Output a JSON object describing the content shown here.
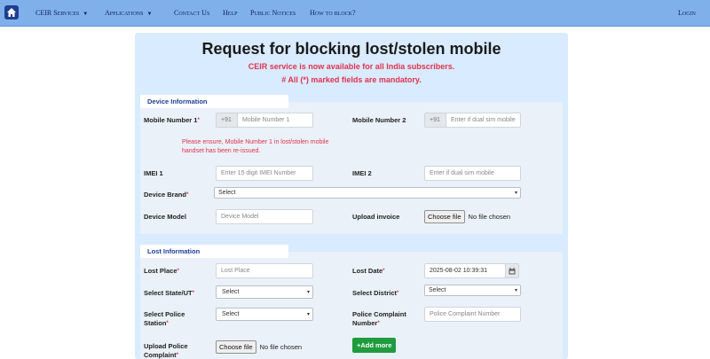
{
  "nav": {
    "items": [
      {
        "label": "CEIR Services",
        "caret": "▼"
      },
      {
        "label": "Applications",
        "caret": "▼"
      },
      {
        "label": "Contact Us"
      },
      {
        "label": "Help"
      },
      {
        "label": "Public Notices"
      },
      {
        "label": "How to block?"
      }
    ],
    "login": "Login"
  },
  "header": {
    "title": "Request for blocking lost/stolen mobile",
    "notice1": "CEIR service is now available for all India subscribers.",
    "notice2": "# All (*) marked fields are mandatory."
  },
  "device": {
    "section_title": "Device Information",
    "mobile1_label": "Mobile Number 1",
    "mobile1_prefix": "+91",
    "mobile1_placeholder": "Mobile Number 1",
    "mobile2_label": "Mobile Number 2",
    "mobile2_prefix": "+91",
    "mobile2_placeholder": "Enter if dual sim mobile",
    "note_line1": "Please ensure, Mobile Number 1 in lost/stolen mobile",
    "note_line2": "handset has been re-issued.",
    "imei1_label": "IMEI 1",
    "imei1_placeholder": "Enter 15 digit IMEI Number",
    "imei2_label": "IMEI 2",
    "imei2_placeholder": "Enter if dual sim mobile",
    "brand_label": "Device Brand",
    "brand_value": "Select",
    "model_label": "Device Model",
    "model_placeholder": "Device Model",
    "invoice_label": "Upload invoice",
    "invoice_button": "Choose file",
    "invoice_status": "No file chosen"
  },
  "lost": {
    "section_title": "Lost Information",
    "place_label": "Lost Place",
    "place_placeholder": "Lost Place",
    "date_label": "Lost Date",
    "date_value": "2025-08-02 10:39:31",
    "state_label": "Select State/UT",
    "state_value": "Select",
    "district_label": "Select District",
    "district_value": "Select",
    "station_label_1": "Select Police",
    "station_label_2": "Station",
    "station_value": "Select",
    "complaint_no_label_1": "Police Complaint",
    "complaint_no_label_2": "Number",
    "complaint_no_placeholder": "Police Complaint Number",
    "upload_label_1": "Upload Police",
    "upload_label_2": "Complaint",
    "upload_button": "Choose file",
    "upload_status": "No file chosen",
    "add_more": "+Add more"
  },
  "colors": {
    "navbar": "#7fb0ea",
    "panel": "#d9ebff",
    "alert_red": "#e0324b",
    "section_title_blue": "#1b3f99",
    "add_button_green": "#1f9c3e"
  }
}
